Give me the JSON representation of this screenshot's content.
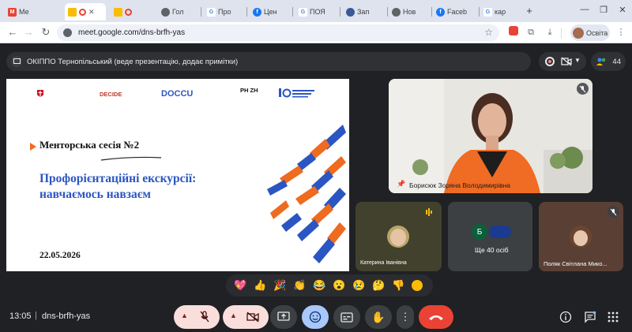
{
  "browser": {
    "tabs": [
      {
        "label": "Ме",
        "fav_color": "#ea4335",
        "fav_text": "M"
      },
      {
        "label": "",
        "fav_color": "#fbbc04",
        "fav_text": ""
      },
      {
        "label": "",
        "fav_color": "#fbbc04",
        "fav_text": ""
      },
      {
        "label": "Гол",
        "fav_color": "#5f6368",
        "fav_text": ""
      },
      {
        "label": "Про",
        "fav_color": "#4285f4",
        "fav_text": "G"
      },
      {
        "label": "Цен",
        "fav_color": "#1877f2",
        "fav_text": "f"
      },
      {
        "label": "ПОЯ",
        "fav_color": "#4285f4",
        "fav_text": "G"
      },
      {
        "label": "Зап",
        "fav_color": "#3b5998",
        "fav_text": ""
      },
      {
        "label": "Нов",
        "fav_color": "#5f6368",
        "fav_text": ""
      },
      {
        "label": "Faceb",
        "fav_color": "#1877f2",
        "fav_text": "f"
      },
      {
        "label": "кар",
        "fav_color": "#4285f4",
        "fav_text": "G"
      }
    ],
    "new_tab": "+",
    "url": "meet.google.com/dns-brfh-yas",
    "profile_label": "Освіта"
  },
  "meet": {
    "presenter_text": "ОКІППО Тернопільський (веде презентацію, додає примітки)",
    "participant_count": "44",
    "slide": {
      "logos": [
        "DECIDE",
        "DOCCU",
        "PH ZH"
      ],
      "title": "Менторська сесія  №2",
      "subtitle_line1": "Профорієнтаційні екскурсії:",
      "subtitle_line2": "навчаємось навзаєм",
      "date": "22.05.2026"
    },
    "tiles": {
      "main_name": "Борисюк Зоряна Володимирівна",
      "tile2_name": "Катерина Іванівна",
      "tile3_initial": "Б",
      "tile3_text": "Ще 40 осіб",
      "tile4_name": "Поляк Світлана Мико..."
    },
    "reactions": [
      "💖",
      "👍",
      "🎉",
      "👏",
      "😂",
      "😮",
      "😢",
      "🤔",
      "👎"
    ],
    "bottom": {
      "time": "13:05",
      "separator": "|",
      "meeting_code": "dns-brfh-yas"
    }
  }
}
